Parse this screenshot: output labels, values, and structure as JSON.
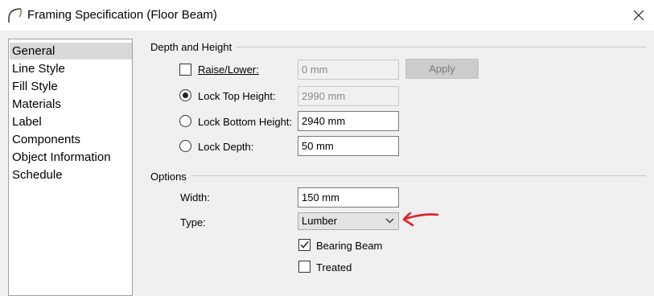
{
  "window": {
    "title": "Framing Specification (Floor Beam)",
    "app_icon": "arc-icon",
    "close_icon": "close-icon"
  },
  "sidebar": {
    "items": [
      {
        "label": "General",
        "selected": true
      },
      {
        "label": "Line Style"
      },
      {
        "label": "Fill Style"
      },
      {
        "label": "Materials"
      },
      {
        "label": "Label"
      },
      {
        "label": "Components"
      },
      {
        "label": "Object Information"
      },
      {
        "label": "Schedule"
      }
    ]
  },
  "depth_height": {
    "title": "Depth and Height",
    "raise_lower": {
      "label": "Raise/Lower:",
      "checked": false,
      "value": "0 mm",
      "enabled": false
    },
    "apply_label": "Apply",
    "lock_top": {
      "label": "Lock Top Height:",
      "selected": true,
      "value": "2990 mm",
      "enabled": false
    },
    "lock_bottom": {
      "label": "Lock Bottom Height:",
      "selected": false,
      "value": "2940 mm"
    },
    "lock_depth": {
      "label": "Lock Depth:",
      "selected": false,
      "value": "50 mm"
    }
  },
  "options": {
    "title": "Options",
    "width": {
      "label": "Width:",
      "value": "150 mm"
    },
    "type": {
      "label": "Type:",
      "value": "Lumber"
    },
    "bearing_beam": {
      "label": "Bearing Beam",
      "checked": true
    },
    "treated": {
      "label": "Treated",
      "checked": false
    }
  },
  "annotation": {
    "color": "#e0202a",
    "icon": "red-arrow-annotation"
  }
}
